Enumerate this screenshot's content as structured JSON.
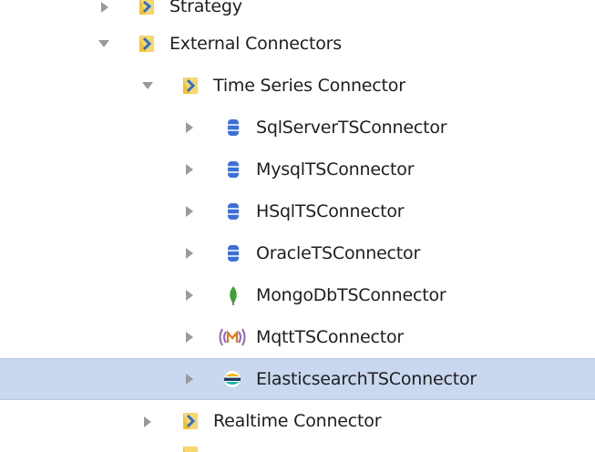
{
  "tree": {
    "nodes": [
      {
        "label": "Strategy",
        "icon": "folder-icon",
        "expanded": false
      },
      {
        "label": "External Connectors",
        "icon": "folder-icon",
        "expanded": true
      },
      {
        "label": "Time Series Connector",
        "icon": "folder-icon",
        "expanded": true
      },
      {
        "label": "SqlServerTSConnector",
        "icon": "database-icon",
        "expanded": false
      },
      {
        "label": "MysqlTSConnector",
        "icon": "database-icon",
        "expanded": false
      },
      {
        "label": "HSqlTSConnector",
        "icon": "database-icon",
        "expanded": false
      },
      {
        "label": "OracleTSConnector",
        "icon": "database-icon",
        "expanded": false
      },
      {
        "label": "MongoDbTSConnector",
        "icon": "mongodb-leaf-icon",
        "expanded": false
      },
      {
        "label": "MqttTSConnector",
        "icon": "mqtt-icon",
        "expanded": false
      },
      {
        "label": "ElasticsearchTSConnector",
        "icon": "elasticsearch-icon",
        "expanded": false,
        "selected": true
      },
      {
        "label": "Realtime Connector",
        "icon": "folder-icon",
        "expanded": false
      }
    ]
  },
  "colors": {
    "selection_background": "#c9d7ef",
    "folder_yellow": "#f2c230",
    "folder_blue": "#3a7bd5",
    "database_blue": "#3c6fd8",
    "mongodb_green": "#3fa037",
    "elastic_teal": "#20b3a8",
    "toggle_gray": "#9a9a9a"
  }
}
